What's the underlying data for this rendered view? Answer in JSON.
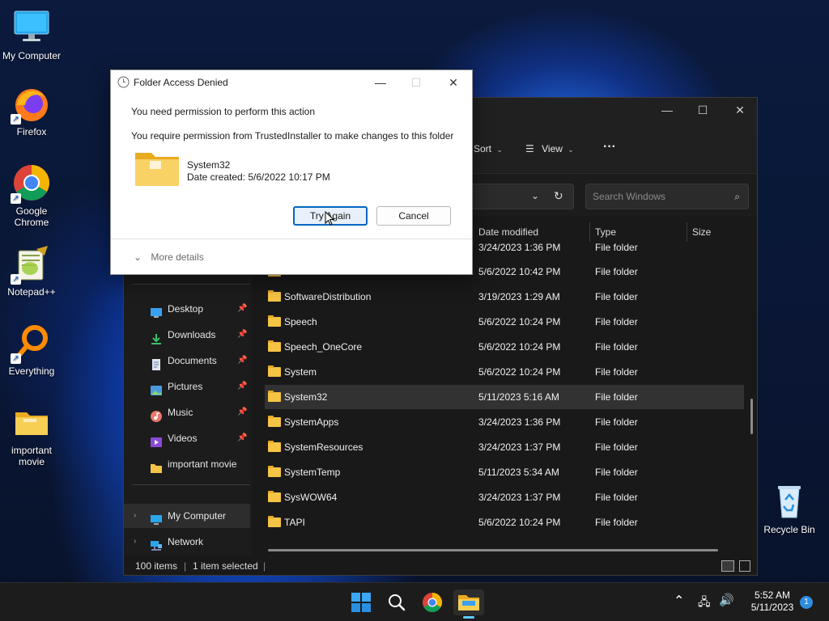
{
  "desktop": {
    "icons": [
      {
        "label": "My Computer",
        "icon": "monitor-icon"
      },
      {
        "label": "Firefox",
        "icon": "firefox-icon"
      },
      {
        "label": "Google Chrome",
        "icon": "chrome-icon"
      },
      {
        "label": "Notepad++",
        "icon": "notepadpp-icon"
      },
      {
        "label": "Everything",
        "icon": "everything-icon"
      },
      {
        "label": "important movie",
        "icon": "folder-icon"
      },
      {
        "label": "Recycle Bin",
        "icon": "recycle-bin-icon"
      }
    ]
  },
  "explorer": {
    "window_controls": [
      "—",
      "☐",
      "✕"
    ],
    "toolbar": {
      "sort_label": "Sort",
      "view_label": "View",
      "more_label": "···"
    },
    "search_placeholder": "Search Windows",
    "nav_items": [
      {
        "label": "Desktop",
        "icon": "desktop-icon",
        "pinned": true
      },
      {
        "label": "Downloads",
        "icon": "downloads-icon",
        "pinned": true
      },
      {
        "label": "Documents",
        "icon": "documents-icon",
        "pinned": true
      },
      {
        "label": "Pictures",
        "icon": "pictures-icon",
        "pinned": true
      },
      {
        "label": "Music",
        "icon": "music-icon",
        "pinned": true
      },
      {
        "label": "Videos",
        "icon": "videos-icon",
        "pinned": true
      },
      {
        "label": "important movie",
        "icon": "folder-icon",
        "pinned": false
      },
      {
        "label": "My Computer",
        "icon": "monitor-icon",
        "pinned": false
      },
      {
        "label": "Network",
        "icon": "network-icon",
        "pinned": false
      }
    ],
    "columns": {
      "date": "Date modified",
      "type": "Type",
      "size": "Size"
    },
    "rows": [
      {
        "name": "",
        "date": "3/24/2023 1:36 PM",
        "type": "File folder"
      },
      {
        "name": "",
        "date": "5/6/2022 10:42 PM",
        "type": "File folder"
      },
      {
        "name": "SoftwareDistribution",
        "date": "3/19/2023 1:29 AM",
        "type": "File folder"
      },
      {
        "name": "Speech",
        "date": "5/6/2022 10:24 PM",
        "type": "File folder"
      },
      {
        "name": "Speech_OneCore",
        "date": "5/6/2022 10:24 PM",
        "type": "File folder"
      },
      {
        "name": "System",
        "date": "5/6/2022 10:24 PM",
        "type": "File folder"
      },
      {
        "name": "System32",
        "date": "5/11/2023 5:16 AM",
        "type": "File folder"
      },
      {
        "name": "SystemApps",
        "date": "3/24/2023 1:36 PM",
        "type": "File folder"
      },
      {
        "name": "SystemResources",
        "date": "3/24/2023 1:37 PM",
        "type": "File folder"
      },
      {
        "name": "SystemTemp",
        "date": "5/11/2023 5:34 AM",
        "type": "File folder"
      },
      {
        "name": "SysWOW64",
        "date": "3/24/2023 1:37 PM",
        "type": "File folder"
      },
      {
        "name": "TAPI",
        "date": "5/6/2022 10:24 PM",
        "type": "File folder"
      }
    ],
    "status": {
      "items": "100 items",
      "selected": "1 item selected"
    }
  },
  "dialog": {
    "title": "Folder Access Denied",
    "controls": [
      "—",
      "☐",
      "✕"
    ],
    "line1": "You need permission to perform this action",
    "line2": "You require permission from TrustedInstaller to make changes to this folder",
    "folder_name": "System32",
    "date_created": "Date created: 5/6/2022 10:17 PM",
    "try_again": "Try Again",
    "cancel": "Cancel",
    "more_details": "More details"
  },
  "taskbar": {
    "time": "5:52 AM",
    "date": "5/11/2023",
    "notification_count": "1"
  }
}
